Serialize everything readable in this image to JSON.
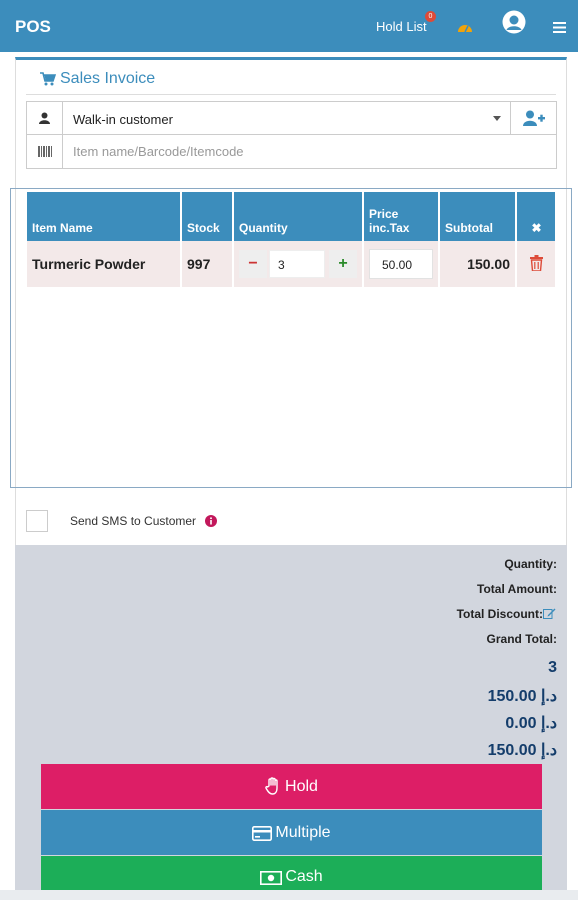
{
  "topbar": {
    "brand": "POS",
    "hold_list_label": "Hold List",
    "hold_count": "0",
    "dashboard_icon": "dashboard-icon",
    "user_icon": "user-avatar-icon",
    "menu_icon": "hamburger-icon",
    "color": "#3c8dbc"
  },
  "invoice": {
    "title": "Sales Invoice",
    "title_icon": "cart-icon",
    "customer_value": "Walk-in customer",
    "item_placeholder": "Item name/Barcode/Itemcode"
  },
  "table": {
    "headers": {
      "item_name": "Item Name",
      "stock": "Stock",
      "quantity": "Quantity",
      "price_line1": "Price",
      "price_line2": "inc.Tax",
      "subtotal": "Subtotal",
      "remove": "✖"
    },
    "rows": [
      {
        "item_name": "Turmeric Powder",
        "stock": "997",
        "quantity": "3",
        "minus": "−",
        "plus": "+",
        "price": "50.00",
        "subtotal": "150.00"
      }
    ]
  },
  "sms": {
    "label": "Send SMS to Customer",
    "checked": false
  },
  "summary": {
    "quantity_label": "Quantity:",
    "total_amount_label": "Total Amount:",
    "total_discount_label": "Total Discount:",
    "grand_total_label": "Grand Total:",
    "quantity_value": "3",
    "total_amount_value": "150.00 د.إ",
    "total_discount_value": "0.00 د.إ",
    "grand_total_value": "150.00 د.إ"
  },
  "buttons": {
    "hold": "Hold",
    "multiple": "Multiple",
    "cash": "Cash",
    "hold_color": "#dd1e66",
    "multiple_color": "#3c8dbc",
    "cash_color": "#1cae58"
  }
}
